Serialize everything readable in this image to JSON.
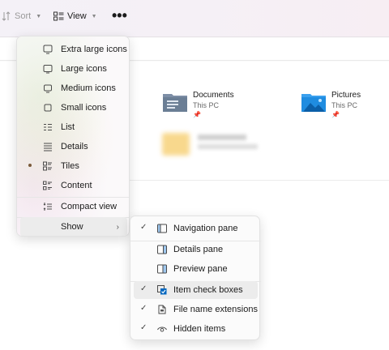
{
  "toolbar": {
    "sort_label": "Sort",
    "view_label": "View",
    "more_label": "•••"
  },
  "files": [
    {
      "name": "Documents",
      "location": "This PC",
      "icon": "documents-folder-icon"
    },
    {
      "name": "Pictures",
      "location": "This PC",
      "icon": "pictures-folder-icon"
    }
  ],
  "view_menu": {
    "items": [
      {
        "label": "Extra large icons",
        "icon": "monitor-icon"
      },
      {
        "label": "Large icons",
        "icon": "monitor-icon"
      },
      {
        "label": "Medium icons",
        "icon": "monitor-icon"
      },
      {
        "label": "Small icons",
        "icon": "small-icons-icon"
      },
      {
        "label": "List",
        "icon": "list-icon"
      },
      {
        "label": "Details",
        "icon": "details-icon"
      },
      {
        "label": "Tiles",
        "icon": "tiles-icon",
        "selected": true
      },
      {
        "label": "Content",
        "icon": "content-icon"
      },
      {
        "label": "Compact view",
        "icon": "compact-view-icon"
      }
    ],
    "show_label": "Show",
    "show_arrow": "›"
  },
  "show_menu": {
    "items": [
      {
        "label": "Navigation pane",
        "checked": true,
        "icon": "navigation-pane-icon"
      },
      {
        "label": "Details pane",
        "checked": false,
        "icon": "details-pane-icon"
      },
      {
        "label": "Preview pane",
        "checked": false,
        "icon": "preview-pane-icon"
      },
      {
        "label": "Item check boxes",
        "checked": true,
        "icon": "item-check-boxes-icon"
      },
      {
        "label": "File name extensions",
        "checked": true,
        "icon": "file-extension-icon"
      },
      {
        "label": "Hidden items",
        "checked": true,
        "icon": "eye-icon"
      }
    ],
    "check_glyph": "✓"
  },
  "colors": {
    "accent": "#0067c0",
    "folder_blue": "#1f8ce0",
    "folder_gray": "#6b7e95"
  }
}
